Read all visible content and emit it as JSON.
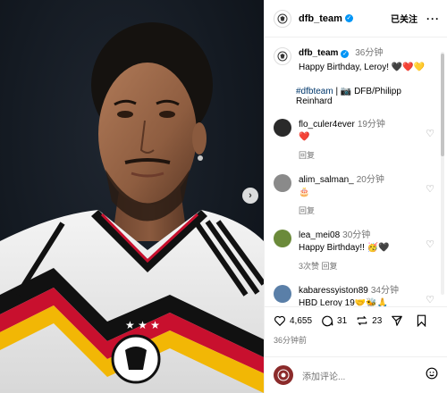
{
  "post": {
    "username": "dfb_team",
    "follow_label": "已关注",
    "more_label": "···",
    "caption_time": "36分钟",
    "caption_text": "Happy Birthday, Leroy! 🖤❤️💛",
    "hashtag": "#dfbteam",
    "credit": " | 📷 DFB/Philipp Reinhard",
    "likes": "4,655",
    "comments_count": "31",
    "shares": "23",
    "posted_ago": "36分钟前",
    "add_comment_placeholder": "添加评论..."
  },
  "comments": [
    {
      "user": "flo_culer4ever",
      "time": "19分钟",
      "text": "❤️",
      "reply": "回复",
      "avatar_color": "#2a2a2a"
    },
    {
      "user": "alim_salman_",
      "time": "20分钟",
      "text": "🎂",
      "reply": "回复",
      "avatar_color": "#8a8a8a"
    },
    {
      "user": "lea_mei08",
      "time": "30分钟",
      "text": "Happy Birthday!! 🥳🖤",
      "reply": "3次赞   回复",
      "avatar_color": "#6b8a3a"
    },
    {
      "user": "kabaressyiston89",
      "time": "34分钟",
      "text": "HBD Leroy 19🤝🐝🙏",
      "reply": "",
      "avatar_color": "#5a7fa8"
    }
  ],
  "icons": [
    "dfb-logo-icon",
    "verified-icon",
    "heart-icon",
    "comment-icon",
    "repost-icon",
    "share-icon",
    "bookmark-icon",
    "emoji-icon",
    "chevron-right-icon"
  ],
  "colors": {
    "link": "#00376b",
    "verified": "#0095f6",
    "muted": "#737373"
  }
}
